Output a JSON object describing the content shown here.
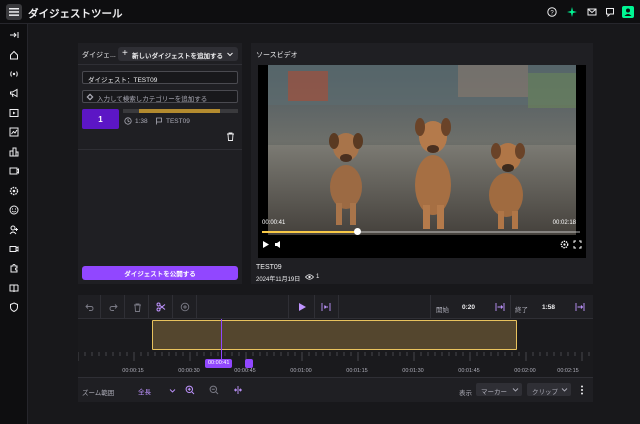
{
  "app": {
    "title": "ダイジェストツール"
  },
  "left_panel": {
    "title": "ダイジェ...",
    "add_new_label": "新しいダイジェストを追加する",
    "digest_title_value": "ダイジェスト：TEST09",
    "category_placeholder": "入力して検索しカテゴリーを追加する",
    "clip": {
      "number": "1",
      "duration": "1:38",
      "tag": "TEST09",
      "progress": 0.7
    },
    "publish_label": "ダイジェストを公開する"
  },
  "video_panel": {
    "title": "ソースビデオ",
    "time_current": "00:00:41",
    "time_total": "00:02:18",
    "progress": 0.3,
    "video_name": "TEST09",
    "video_date": "2024年11月19日",
    "views": "1"
  },
  "timeline": {
    "start_label": "開始",
    "start_value": "0:20",
    "end_label": "終了",
    "end_value": "1:58",
    "playhead_time": "00:00:41",
    "ticks": [
      "00:00:15",
      "00:00:30",
      "00:00:45",
      "00:01:00",
      "00:01:15",
      "00:01:30",
      "00:01:45",
      "00:02:00",
      "00:02:15"
    ],
    "zoom_label": "ズーム範囲",
    "zoom_value": "全長",
    "show_label": "表示",
    "marker_select": "マーカー",
    "clip_select": "クリップ"
  },
  "icons": {
    "top": [
      "help-icon",
      "sparkle-icon",
      "mail-icon",
      "chat-icon",
      "user-icon"
    ],
    "nav": [
      "collapse-icon",
      "home-icon",
      "broadcast-icon",
      "megaphone-icon",
      "video-library-icon",
      "analytics-icon",
      "community-icon",
      "stream-icon",
      "settings-icon",
      "emote-icon",
      "user-add-icon",
      "camera-icon",
      "extension-icon",
      "book-icon",
      "shield-icon"
    ]
  },
  "colors": {
    "accent": "#9147ff",
    "highlight": "#f7c948",
    "clip_bg": "#5c16c5"
  }
}
